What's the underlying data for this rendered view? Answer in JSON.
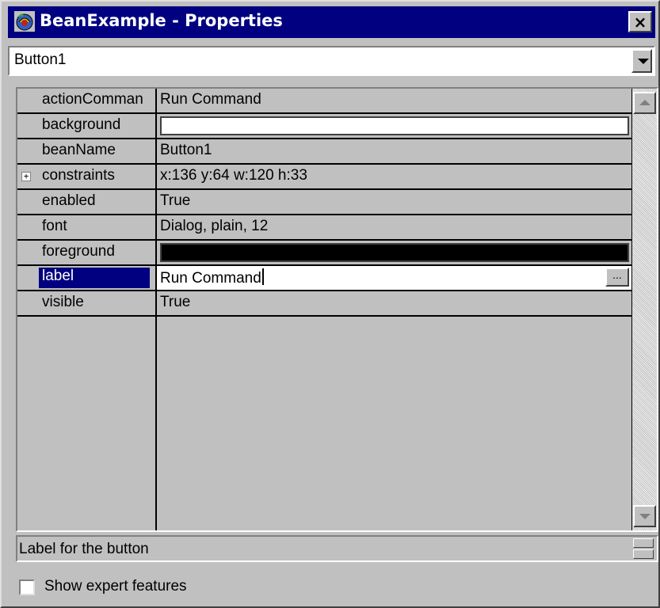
{
  "window": {
    "title": "BeanExample - Properties",
    "close_glyph": "×",
    "icon": "bean-app-icon"
  },
  "bean_selector": {
    "value": "Button1"
  },
  "properties": [
    {
      "name": "actionCommand",
      "display_name": "actionComman",
      "value": "Run Command",
      "type": "text"
    },
    {
      "name": "background",
      "value": "",
      "type": "color",
      "color": "#ffffff"
    },
    {
      "name": "beanName",
      "value": "Button1",
      "type": "text"
    },
    {
      "name": "constraints",
      "value": "x:136 y:64 w:120 h:33",
      "type": "text",
      "expandable": true,
      "expand_glyph": "+"
    },
    {
      "name": "enabled",
      "value": "True",
      "type": "text"
    },
    {
      "name": "font",
      "value": "Dialog, plain, 12",
      "type": "text"
    },
    {
      "name": "foreground",
      "value": "",
      "type": "color",
      "color": "#000000"
    },
    {
      "name": "label",
      "value": "Run Command",
      "type": "edit",
      "selected": true,
      "button_label": "..."
    },
    {
      "name": "visible",
      "value": "True",
      "type": "text"
    }
  ],
  "status": {
    "description": "Label for the button"
  },
  "options": {
    "show_expert_label": "Show expert features",
    "show_expert_checked": false
  },
  "colors": {
    "titlebar": "#000080",
    "face": "#c0c0c0",
    "selection": "#000080"
  }
}
